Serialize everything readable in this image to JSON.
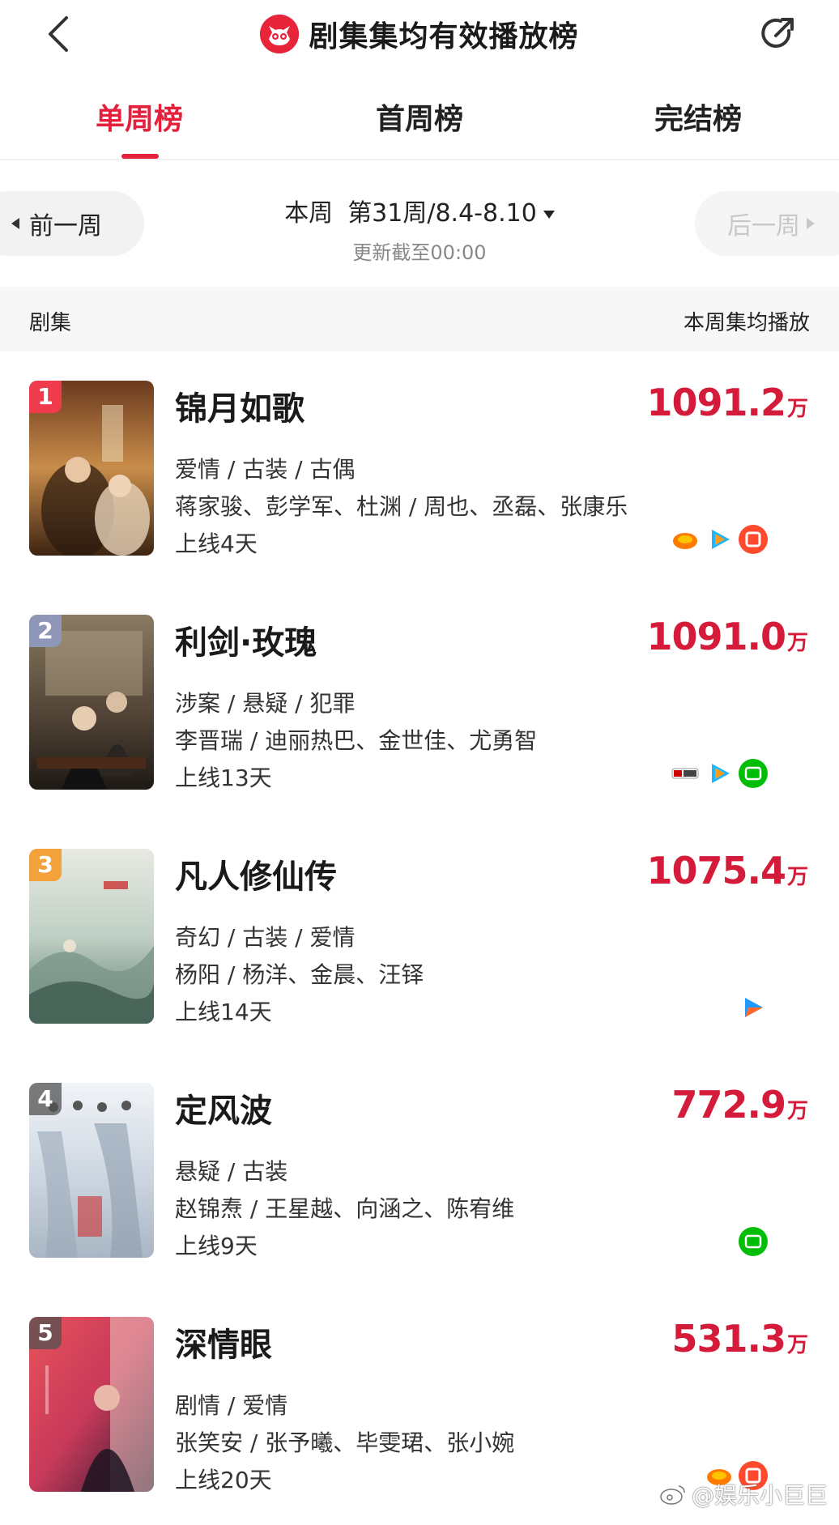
{
  "header": {
    "title": "剧集集均有效播放榜"
  },
  "tabs": [
    {
      "label": "单周榜",
      "active": true
    },
    {
      "label": "首周榜",
      "active": false
    },
    {
      "label": "完结榜",
      "active": false
    }
  ],
  "week": {
    "prev_label": "前一周",
    "next_label": "后一周",
    "current_label": "本周",
    "week_range": "第31周/8.4-8.10",
    "update_text": "更新截至00:00"
  },
  "columns": {
    "left": "剧集",
    "right": "本周集均播放"
  },
  "items": [
    {
      "rank": "1",
      "name": "锦月如歌",
      "genres": "爱情 / 古装 / 古偶",
      "cast": "蒋家骏、彭学军、杜渊 / 周也、丞磊、张康乐",
      "days": "上线4天",
      "score": "1091.2",
      "unit": "万",
      "platforms": [
        "mango-tv-icon",
        "tencent-video-icon",
        "youku-icon"
      ]
    },
    {
      "rank": "2",
      "name": "利剑·玫瑰",
      "genres": "涉案 / 悬疑 / 犯罪",
      "cast": "李晋瑞 / 迪丽热巴、金世佳、尤勇智",
      "days": "上线13天",
      "score": "1091.0",
      "unit": "万",
      "platforms": [
        "cctv8-icon",
        "tencent-video-icon",
        "iqiyi-icon"
      ]
    },
    {
      "rank": "3",
      "name": "凡人修仙传",
      "genres": "奇幻 / 古装 / 爱情",
      "cast": "杨阳 / 杨洋、金晨、汪铎",
      "days": "上线14天",
      "score": "1075.4",
      "unit": "万",
      "platforms": [
        "youku-icon"
      ]
    },
    {
      "rank": "4",
      "name": "定风波",
      "genres": "悬疑 / 古装",
      "cast": "赵锦焘 / 王星越、向涵之、陈宥维",
      "days": "上线9天",
      "score": "772.9",
      "unit": "万",
      "platforms": [
        "iqiyi-icon"
      ]
    },
    {
      "rank": "5",
      "name": "深情眼",
      "genres": "剧情 / 爱情",
      "cast": "张笑安 / 张予曦、毕雯珺、张小婉",
      "days": "上线20天",
      "score": "531.3",
      "unit": "万",
      "platforms": [
        "mango-tv-icon",
        "youku-icon"
      ]
    }
  ],
  "watermark": "@娱乐小巨巨",
  "colors": {
    "accent": "#e5203d",
    "score": "#d41c3a"
  }
}
